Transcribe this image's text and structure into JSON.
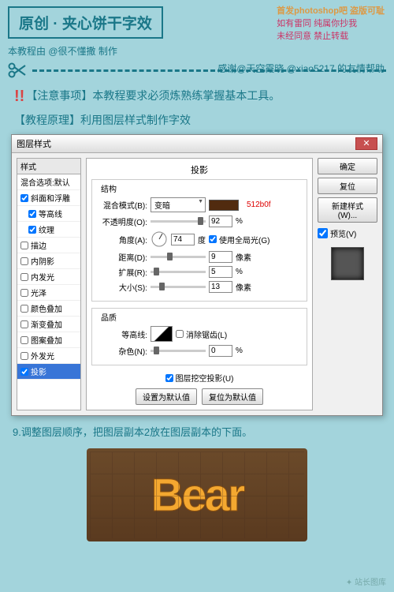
{
  "header": {
    "title": "原创 · 夹心饼干字效",
    "topRight1": "首发photoshop吧 盗版可耻",
    "topRight2": "如有雷同 纯属你抄我",
    "topRight3": "未经同意 禁止转载",
    "author": "本教程由 @很不懂撒 制作",
    "credits": "感谢@天空霞晓 @xiao5217 的友情帮助"
  },
  "notes": {
    "line1": "【注意事项】本教程要求必须炼熟练掌握基本工具。",
    "line2": "【教程原理】利用图层样式制作字效"
  },
  "dialog": {
    "title": "图层样式",
    "leftHead": "样式",
    "leftItems": [
      {
        "label": "混合选项:默认",
        "checked": false,
        "nosub": true
      },
      {
        "label": "斜面和浮雕",
        "checked": true
      },
      {
        "label": "等高线",
        "checked": true,
        "indent": true
      },
      {
        "label": "纹理",
        "checked": true,
        "indent": true
      },
      {
        "label": "描边",
        "checked": false
      },
      {
        "label": "内阴影",
        "checked": false
      },
      {
        "label": "内发光",
        "checked": false
      },
      {
        "label": "光泽",
        "checked": false
      },
      {
        "label": "颜色叠加",
        "checked": false
      },
      {
        "label": "渐变叠加",
        "checked": false
      },
      {
        "label": "图案叠加",
        "checked": false
      },
      {
        "label": "外发光",
        "checked": false
      },
      {
        "label": "投影",
        "checked": true,
        "sel": true
      }
    ],
    "panelTitle": "投影",
    "fs1": "结构",
    "fs2": "品质",
    "blendLabel": "混合模式(B):",
    "blendValue": "变暗",
    "hex": "512b0f",
    "opacityLabel": "不透明度(O):",
    "opacityVal": "92",
    "angleLabel": "角度(A):",
    "angleVal": "74",
    "angleUnit": "度",
    "globalLight": "使用全局光(G)",
    "distLabel": "距离(D):",
    "distVal": "9",
    "spreadLabel": "扩展(R):",
    "spreadVal": "5",
    "sizeLabel": "大小(S):",
    "sizeVal": "13",
    "px": "像素",
    "pct": "%",
    "contourLabel": "等高线:",
    "antiAlias": "消除锯齿(L)",
    "noiseLabel": "杂色(N):",
    "noiseVal": "0",
    "knockOut": "图层挖空投影(U)",
    "setDefault": "设置为默认值",
    "resetDefault": "复位为默认值",
    "ok": "确定",
    "cancel": "复位",
    "newStyle": "新建样式(W)...",
    "preview": "预览(V)"
  },
  "step": "9.调整图层顺序，把图层副本2放在图层副本的下面。",
  "bear": "Bear",
  "watermark": "✦ 站长图库"
}
